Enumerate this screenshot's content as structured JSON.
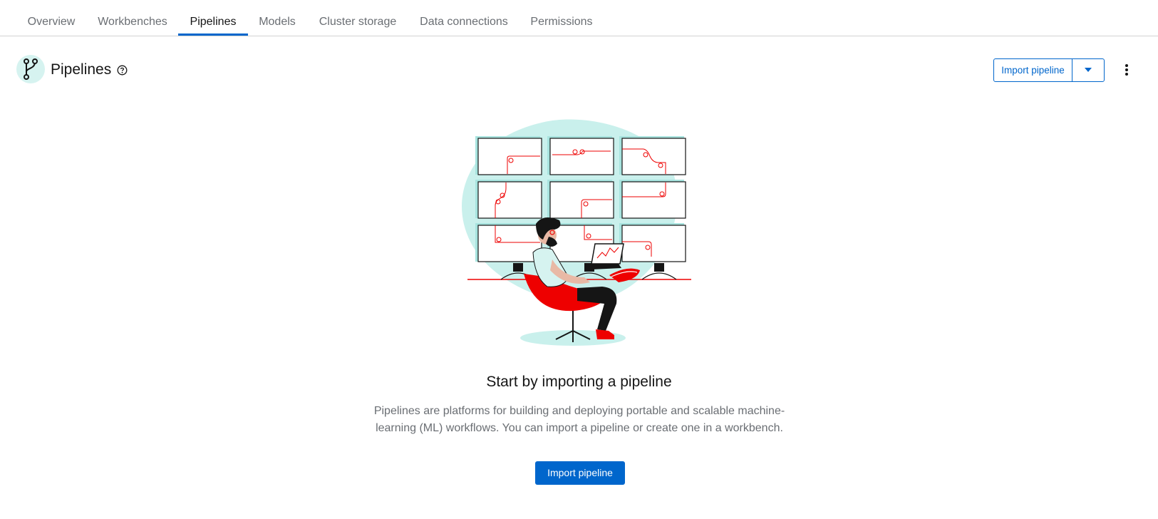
{
  "tabs": [
    {
      "label": "Overview",
      "active": false
    },
    {
      "label": "Workbenches",
      "active": false
    },
    {
      "label": "Pipelines",
      "active": true
    },
    {
      "label": "Models",
      "active": false
    },
    {
      "label": "Cluster storage",
      "active": false
    },
    {
      "label": "Data connections",
      "active": false
    },
    {
      "label": "Permissions",
      "active": false
    }
  ],
  "header": {
    "title": "Pipelines",
    "icon": "pipeline-branch-icon",
    "help_icon": "help-circle-icon",
    "import_button_label": "Import pipeline",
    "dropdown_icon": "caret-down-icon",
    "kebab_icon": "kebab-menu-icon"
  },
  "empty_state": {
    "illustration": "person-at-monitors-illustration",
    "title": "Start by importing a pipeline",
    "body": "Pipelines are platforms for building and deploying portable and scalable machine-learning (ML) workflows. You can import a pipeline or create one in a workbench.",
    "button_label": "Import pipeline"
  },
  "colors": {
    "accent": "#0066cc",
    "active_tab_underline": "#0066cc",
    "illustration_teal": "#c9f0ec",
    "illustration_red": "#ee0000"
  }
}
